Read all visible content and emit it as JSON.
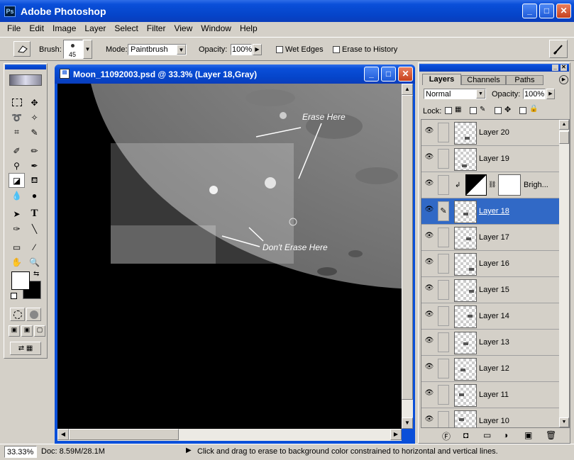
{
  "app": {
    "title": "Adobe Photoshop"
  },
  "menu": [
    "File",
    "Edit",
    "Image",
    "Layer",
    "Select",
    "Filter",
    "View",
    "Window",
    "Help"
  ],
  "options": {
    "brush_label": "Brush:",
    "brush_size": "45",
    "mode_label": "Mode:",
    "mode_value": "Paintbrush",
    "opacity_label": "Opacity:",
    "opacity_value": "100%",
    "wet_edges": "Wet Edges",
    "erase_history": "Erase to History"
  },
  "document": {
    "title": "Moon_11092003.psd @ 33.3% (Layer 18,Gray)",
    "annotation_erase": "Erase Here",
    "annotation_dont": "Don't Erase Here"
  },
  "layers_panel": {
    "tabs": [
      "Layers",
      "Channels",
      "Paths"
    ],
    "blend_mode": "Normal",
    "opacity_label": "Opacity:",
    "opacity_value": "100%",
    "lock_label": "Lock:",
    "layers": [
      {
        "name": "Layer 20",
        "selected": false
      },
      {
        "name": "Layer 19",
        "selected": false
      },
      {
        "name": "Brigh...",
        "selected": false,
        "adjustment": true
      },
      {
        "name": "Layer 18",
        "selected": true
      },
      {
        "name": "Layer 17",
        "selected": false
      },
      {
        "name": "Layer 16",
        "selected": false
      },
      {
        "name": "Layer 15",
        "selected": false
      },
      {
        "name": "Layer 14",
        "selected": false
      },
      {
        "name": "Layer 13",
        "selected": false
      },
      {
        "name": "Layer 12",
        "selected": false
      },
      {
        "name": "Layer 11",
        "selected": false
      },
      {
        "name": "Layer 10",
        "selected": false
      }
    ]
  },
  "status": {
    "zoom": "33.33%",
    "doc": "Doc: 8.59M/28.1M",
    "hint": "Click and drag to erase to background color constrained to horizontal and vertical lines."
  },
  "colors": {
    "title_blue": "#0a4fd9",
    "selection_blue": "#3169c6"
  }
}
